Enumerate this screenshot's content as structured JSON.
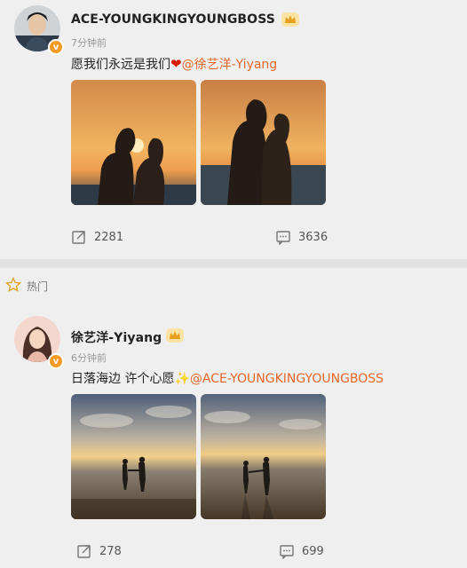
{
  "posts": [
    {
      "username": "ACE-YOUNGKINGYOUNGBOSS",
      "time": "7分钟前",
      "text": "愿我们永远是我们",
      "heart": "❤",
      "mention": "@徐艺洋-Yiyang",
      "verified_badge": "v",
      "repost_count": "2281",
      "comment_count": "3636"
    },
    {
      "username": "徐艺洋-Yiyang",
      "time": "6分钟前",
      "text": "日落海边 许个心愿",
      "sparkle": "✨",
      "mention": "@ACE-YOUNGKINGYOUNGBOSS",
      "verified_badge": "v",
      "repost_count": "278",
      "comment_count": "699"
    }
  ],
  "hot_section": {
    "label": "热门",
    "icon": "star-outline-icon"
  },
  "colors": {
    "mention": "#e8682c",
    "badge": "#f59a23",
    "heart": "#d81e06"
  }
}
